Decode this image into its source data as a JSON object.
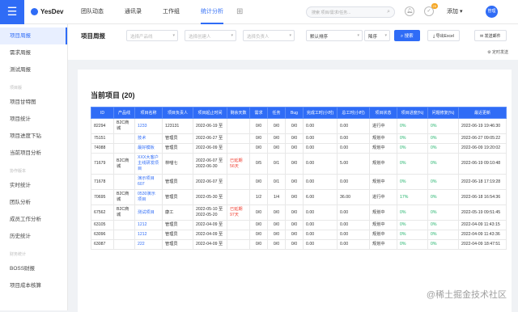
{
  "app": {
    "logo_text": "YesDev"
  },
  "nav": {
    "items": [
      {
        "label": "团队动态",
        "active": false
      },
      {
        "label": "通讯录",
        "active": false
      },
      {
        "label": "工作组",
        "active": false
      },
      {
        "label": "统计分析",
        "active": true
      }
    ],
    "add_glyph": "⊞"
  },
  "search": {
    "placeholder": "搜索 项目/需求/任务..."
  },
  "header": {
    "notify_badge": "25",
    "add_label": "添加 ▾",
    "avatar_text": "管理"
  },
  "sidebar": {
    "items": [
      {
        "label": "项目周报",
        "active": true
      },
      {
        "label": "需求周报",
        "active": false
      },
      {
        "label": "测试周报",
        "active": false
      }
    ],
    "group2_title": "项目版",
    "group2": [
      "项目甘特图",
      "项目统计",
      "项目进度下钻",
      "当前项目分析"
    ],
    "group3_title": "协作版本",
    "group3": [
      "实时统计",
      "团队分析",
      "成员工作分析",
      "历史统计"
    ],
    "group4_title": "财务统计",
    "group4": [
      "BOSS财报",
      "项目成本核算"
    ]
  },
  "filters": {
    "page_title": "项目周报",
    "product_line": "选择产品线",
    "owner": "选择创建人",
    "member": "选择负责人",
    "sort_field": "默认排序",
    "sort_order": "降序",
    "search_button": "搜索",
    "export_button": "导出Excel",
    "mail_button": "发送邮件",
    "timing_label": "定时发送"
  },
  "table": {
    "title": "当前项目 (20)",
    "columns": [
      "ID",
      "产品线",
      "项目名称",
      "项目负责人",
      "项目起止时间",
      "剩余天数",
      "需求",
      "任务",
      "Bug",
      "完成工时(小时)",
      "总工时(小时)",
      "项目状态",
      "项目进度(%)",
      "问题修复(%)",
      "最近更新"
    ],
    "rows": [
      {
        "id": "82294",
        "line": "B2C商城",
        "name": "1233",
        "owner": "123131",
        "period": "2022-06-19 至",
        "remain": "",
        "req": "0/0",
        "task": "0/0",
        "bug": "0/0",
        "done": "0.00",
        "total": "0.00",
        "status": "进行中",
        "progress": "0%",
        "fix": "0%",
        "updated": "2022-06-19 19:46:30"
      },
      {
        "id": "75151",
        "line": "",
        "name": "技术",
        "owner": "管理员",
        "period": "2022-06-27 至",
        "remain": "",
        "req": "0/0",
        "task": "0/0",
        "bug": "0/0",
        "done": "0.00",
        "total": "0.00",
        "status": "规划中",
        "progress": "0%",
        "fix": "0%",
        "updated": "2022-06-27 09:05:22"
      },
      {
        "id": "74088",
        "line": "",
        "name": "最好模板",
        "owner": "管理员",
        "period": "2022-06-09 至",
        "remain": "",
        "req": "0/0",
        "task": "0/0",
        "bug": "0/0",
        "done": "0.00",
        "total": "0.00",
        "status": "规划中",
        "progress": "0%",
        "fix": "0%",
        "updated": "2022-06-09 19:20:02"
      },
      {
        "id": "71679",
        "line": "B2C商城",
        "name": "XXX大客户主线研发项目",
        "owner": "林喵七",
        "period": "2022-06-07 至 2022-06-30",
        "remain": "已延期 56天",
        "req": "0/5",
        "task": "0/1",
        "bug": "0/0",
        "done": "0.00",
        "total": "5.00",
        "status": "规划中",
        "progress": "0%",
        "fix": "0%",
        "updated": "2022-06-19 09:10:48"
      },
      {
        "id": "71678",
        "line": "",
        "name": "演示项目607",
        "owner": "管理员",
        "period": "2022-06-07 至",
        "remain": "",
        "req": "0/0",
        "task": "0/1",
        "bug": "0/0",
        "done": "0.00",
        "total": "0.00",
        "status": "规划中",
        "progress": "0%",
        "fix": "0%",
        "updated": "2022-06-18 17:19:28"
      },
      {
        "id": "70695",
        "line": "B2C商城",
        "name": "0530演示项目",
        "owner": "管理员",
        "period": "2022-05-30 至",
        "remain": "",
        "req": "1/2",
        "task": "1/4",
        "bug": "0/0",
        "done": "6.00",
        "total": "36.00",
        "status": "进行中",
        "progress": "17%",
        "fix": "0%",
        "updated": "2022-06-18 16:54:36"
      },
      {
        "id": "67562",
        "line": "B2C商城",
        "name": "测试项目",
        "owner": "康工",
        "period": "2022-05-10 至 2022-05-20",
        "remain": "已延期 97天",
        "req": "0/0",
        "task": "0/0",
        "bug": "0/0",
        "done": "0.00",
        "total": "0.00",
        "status": "规划中",
        "progress": "0%",
        "fix": "0%",
        "updated": "2022-05-19 09:51:45"
      },
      {
        "id": "63105",
        "line": "",
        "name": "1212",
        "owner": "管理员",
        "period": "2022-04-09 至",
        "remain": "",
        "req": "0/0",
        "task": "0/0",
        "bug": "0/0",
        "done": "0.00",
        "total": "0.00",
        "status": "规划中",
        "progress": "0%",
        "fix": "0%",
        "updated": "2022-04-09 11:43:15"
      },
      {
        "id": "63096",
        "line": "",
        "name": "1212",
        "owner": "管理员",
        "period": "2022-04-09 至",
        "remain": "",
        "req": "0/0",
        "task": "0/0",
        "bug": "0/0",
        "done": "0.00",
        "total": "0.00",
        "status": "规划中",
        "progress": "0%",
        "fix": "0%",
        "updated": "2022-04-09 11:43:36"
      },
      {
        "id": "63087",
        "line": "",
        "name": "222",
        "owner": "管理员",
        "period": "2022-04-09 至",
        "remain": "",
        "req": "0/0",
        "task": "0/0",
        "bug": "0/0",
        "done": "0.00",
        "total": "0.00",
        "status": "规划中",
        "progress": "0%",
        "fix": "0%",
        "updated": "2022-04-09 18:47:51"
      }
    ]
  },
  "watermark": "@稀土掘金技术社区",
  "colors": {
    "accent": "#2f6cf6",
    "warn": "#f04134",
    "ok": "#21b36b"
  }
}
